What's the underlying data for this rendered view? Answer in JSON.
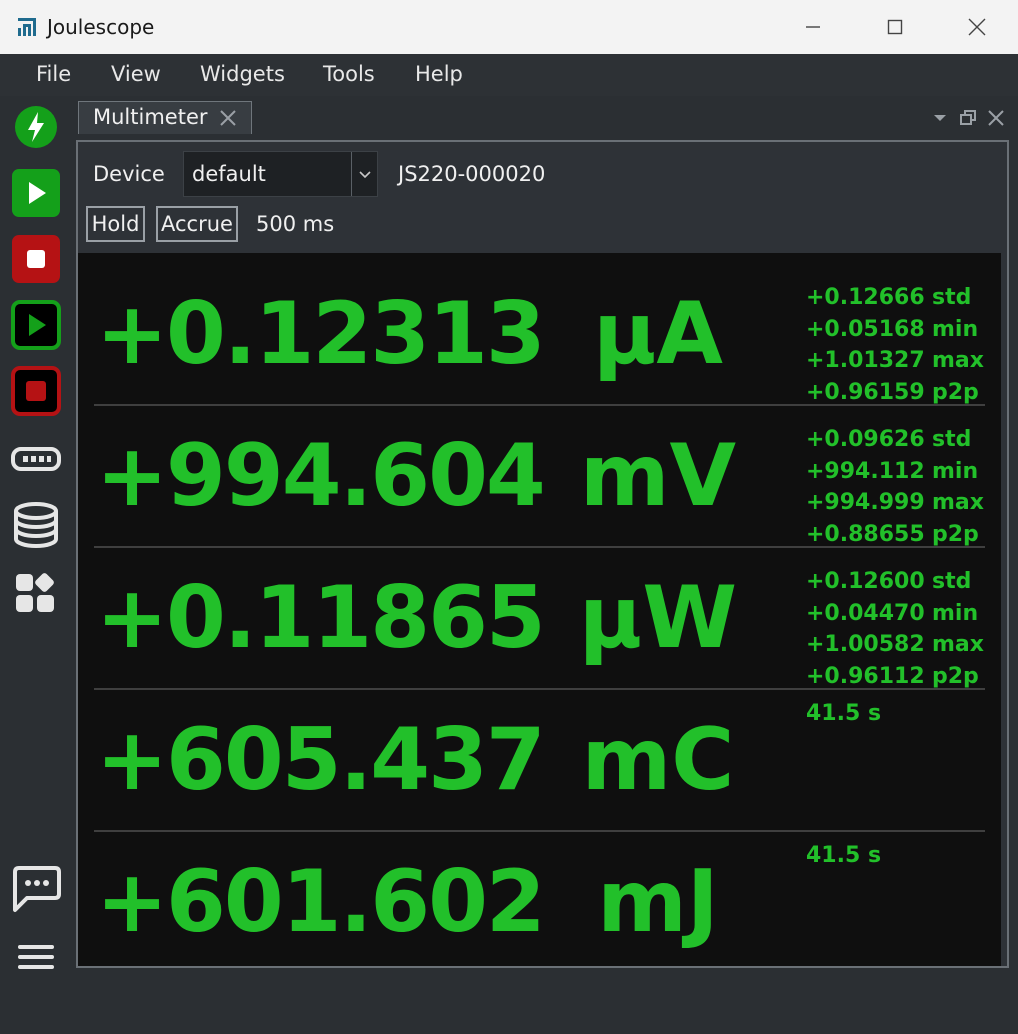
{
  "window": {
    "title": "Joulescope"
  },
  "colors": {
    "accent_green": "#22c02a",
    "stop_red": "#b51214",
    "panel_bg": "#0f0f0f"
  },
  "menu": [
    "File",
    "View",
    "Widgets",
    "Tools",
    "Help"
  ],
  "toolbar": {
    "icons": [
      "lightning-icon",
      "play-icon",
      "stop-icon",
      "record-play-icon",
      "record-stop-icon",
      "device-icon",
      "database-icon",
      "widgets-icon",
      "chat-icon",
      "hamburger-menu-icon"
    ]
  },
  "dock": {
    "tab_label": "Multimeter"
  },
  "controls": {
    "device_label": "Device",
    "device_value": "default",
    "device_serial": "JS220-000020",
    "hold_label": "Hold",
    "accrue_label": "Accrue",
    "interval_label": "500 ms"
  },
  "measurements": [
    {
      "value": "+0.12313",
      "unit": "µA",
      "stats": [
        {
          "value": "+0.12666",
          "name": "std"
        },
        {
          "value": "+0.05168",
          "name": "min"
        },
        {
          "value": "+1.01327",
          "name": "max"
        },
        {
          "value": "+0.96159",
          "name": "p2p"
        }
      ]
    },
    {
      "value": "+994.604",
      "unit": "mV",
      "stats": [
        {
          "value": "+0.09626",
          "name": "std"
        },
        {
          "value": "+994.112",
          "name": "min"
        },
        {
          "value": "+994.999",
          "name": "max"
        },
        {
          "value": "+0.88655",
          "name": "p2p"
        }
      ]
    },
    {
      "value": "+0.11865",
      "unit": "µW",
      "stats": [
        {
          "value": "+0.12600",
          "name": "std"
        },
        {
          "value": "+0.04470",
          "name": "min"
        },
        {
          "value": "+1.00582",
          "name": "max"
        },
        {
          "value": "+0.96112",
          "name": "p2p"
        }
      ]
    },
    {
      "value": "+605.437",
      "unit": "mC",
      "duration": "41.5 s"
    },
    {
      "value": "+601.602",
      "unit": "mJ",
      "duration": "41.5 s"
    }
  ]
}
